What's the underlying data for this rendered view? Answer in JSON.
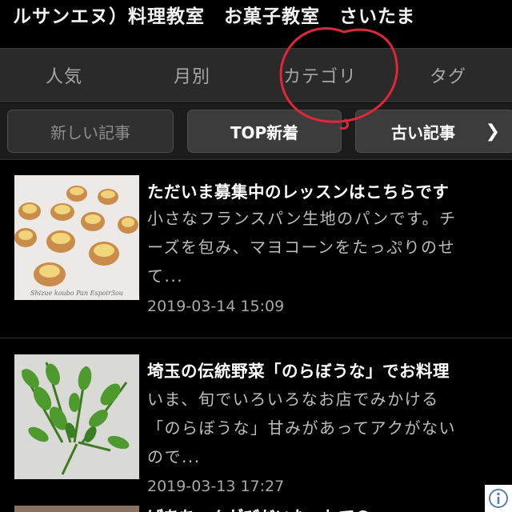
{
  "header": {
    "blog_title": "ルサンエヌ）料理教室　お菓子教室　さいたま"
  },
  "tabs": [
    {
      "label": "人気"
    },
    {
      "label": "月別"
    },
    {
      "label": "カテゴリ"
    },
    {
      "label": "タグ"
    }
  ],
  "pager": {
    "prev_label": "新しい記事",
    "top_label": "TOP新着",
    "next_label": "古い記事",
    "next_icon": "chevron-right-icon"
  },
  "articles": [
    {
      "title": "ただいま募集中のレッスンはこちらです",
      "excerpt_lines": [
        "小さなフランスパン生地のパンです。チ",
        "ーズを包み、マヨコーンをたっぷりのせ",
        "て..."
      ],
      "date": "2019-03-14 15:09",
      "thumb_caption": "Shizue koubo Pan Espoir3ou",
      "thumb_subject": "cheese-mayo-corn-buns"
    },
    {
      "title": "埼玉の伝統野菜「のらぼうな」でお料理",
      "excerpt_lines": [
        "いま、旬でいろいろなお店でみかける",
        "「のらぼうな」甘みがあってアクがない",
        "ので..."
      ],
      "date": "2019-03-13 17:27",
      "thumb_subject": "norabouna-greens"
    },
    {
      "title": "ばあちゃんがびだいたーしての"
    }
  ],
  "annotation": {
    "color": "#e0263a",
    "shape": "hand-drawn-circle-around-category-tab"
  },
  "badge_icon": "info-icon",
  "colors": {
    "background": "#000000",
    "tabbar": "#2a2a2a",
    "button": "#3c3c3c"
  }
}
